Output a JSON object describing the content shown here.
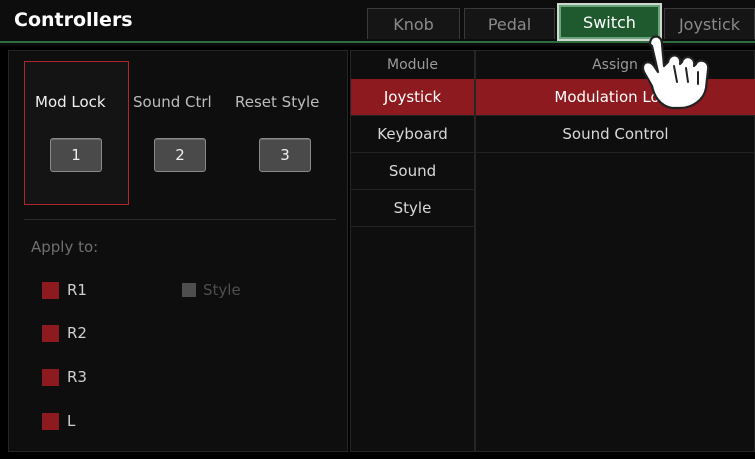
{
  "header": {
    "title": "Controllers",
    "tabs": [
      {
        "label": "Knob",
        "active": false
      },
      {
        "label": "Pedal",
        "active": false
      },
      {
        "label": "Switch",
        "active": true
      },
      {
        "label": "Joystick",
        "active": false
      }
    ]
  },
  "switches": {
    "items": [
      {
        "label": "Mod Lock",
        "button": "1",
        "selected": true
      },
      {
        "label": "Sound Ctrl",
        "button": "2",
        "selected": false
      },
      {
        "label": "Reset Style",
        "button": "3",
        "selected": false
      }
    ]
  },
  "apply": {
    "label": "Apply to:",
    "options": [
      {
        "label": "R1",
        "enabled": true
      },
      {
        "label": "R2",
        "enabled": true
      },
      {
        "label": "R3",
        "enabled": true
      },
      {
        "label": "L",
        "enabled": true
      },
      {
        "label": "Style",
        "enabled": false
      }
    ]
  },
  "module": {
    "header": "Module",
    "items": [
      "Joystick",
      "Keyboard",
      "Sound",
      "Style"
    ],
    "selected_index": 0
  },
  "assign": {
    "header": "Assign",
    "items": [
      "Modulation Lock",
      "Sound Control"
    ],
    "selected_index": 0
  },
  "colors": {
    "accent_red": "#8c1a1e",
    "active_tab_green": "#1f5a2e"
  },
  "icons": {
    "pointer": "hand-pointer-icon"
  }
}
